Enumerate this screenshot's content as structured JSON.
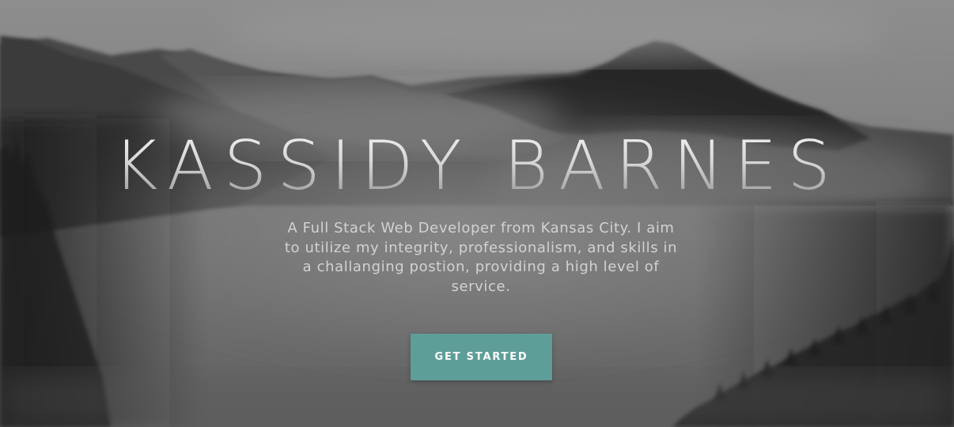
{
  "hero": {
    "name": "KASSIDY BARNES",
    "bio": "A Full Stack Web Developer from Kansas City. I aim to utilize my integrity, professionalism, and skills in a challanging postion, providing a high level of service.",
    "cta_label": "GET STARTED"
  },
  "colors": {
    "button": "#5e9e99",
    "button_text": "#ffffff",
    "subtitle_text": "#d2d2d2"
  }
}
